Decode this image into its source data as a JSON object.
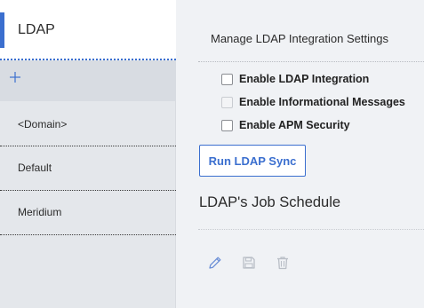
{
  "sidebar": {
    "title": "LDAP",
    "add_icon": "plus-icon",
    "items": [
      {
        "label": "<Domain>"
      },
      {
        "label": "Default"
      },
      {
        "label": "Meridium"
      }
    ]
  },
  "main": {
    "title": "Manage LDAP Integration Settings",
    "checkboxes": [
      {
        "label": "Enable LDAP Integration",
        "checked": false,
        "disabled": false
      },
      {
        "label": "Enable Informational Messages",
        "checked": false,
        "disabled": true
      },
      {
        "label": "Enable APM Security",
        "checked": false,
        "disabled": false
      }
    ],
    "sync_button_label": "Run LDAP Sync",
    "job_schedule_title": "LDAP's Job Schedule",
    "toolbar": {
      "edit_icon": "pencil-icon",
      "save_icon": "floppy-disk-icon",
      "delete_icon": "trash-icon"
    }
  },
  "colors": {
    "accent": "#3b6fcf",
    "sidebar_bg": "#e4e7eb",
    "main_bg": "#f0f2f5",
    "icon_active": "#6b8fd6",
    "icon_disabled": "#b9bec6"
  }
}
